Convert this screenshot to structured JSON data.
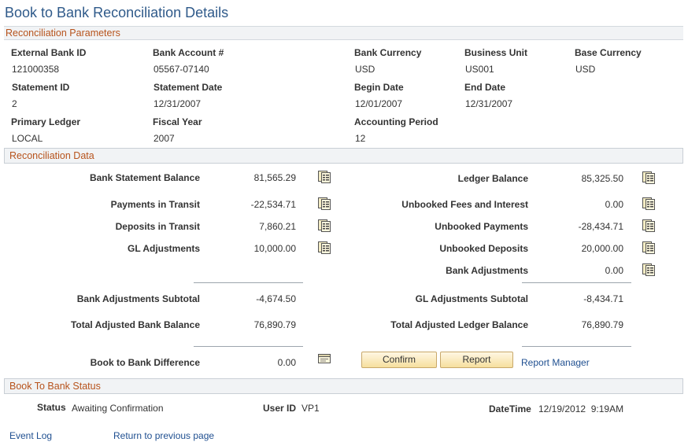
{
  "page": {
    "title": "Book to Bank Reconciliation Details"
  },
  "parameters": {
    "section_title": "Reconciliation Parameters",
    "external_bank_id": {
      "label": "External Bank ID",
      "value": "121000358"
    },
    "bank_account": {
      "label": "Bank Account #",
      "value": "05567-07140"
    },
    "bank_currency": {
      "label": "Bank Currency",
      "value": "USD"
    },
    "business_unit": {
      "label": "Business Unit",
      "value": "US001"
    },
    "base_currency": {
      "label": "Base Currency",
      "value": "USD"
    },
    "statement_id": {
      "label": "Statement ID",
      "value": "2"
    },
    "statement_date": {
      "label": "Statement Date",
      "value": "12/31/2007"
    },
    "begin_date": {
      "label": "Begin Date",
      "value": "12/01/2007"
    },
    "end_date": {
      "label": "End Date",
      "value": "12/31/2007"
    },
    "primary_ledger": {
      "label": "Primary Ledger",
      "value": "LOCAL"
    },
    "fiscal_year": {
      "label": "Fiscal Year",
      "value": "2007"
    },
    "accounting_period": {
      "label": "Accounting Period",
      "value": "12"
    }
  },
  "recon": {
    "section_title": "Reconciliation Data",
    "bank_statement_balance": {
      "label": "Bank Statement Balance",
      "value": "81,565.29"
    },
    "payments_in_transit": {
      "label": "Payments in Transit",
      "value": "-22,534.71"
    },
    "deposits_in_transit": {
      "label": "Deposits in Transit",
      "value": "7,860.21"
    },
    "gl_adjustments": {
      "label": "GL Adjustments",
      "value": "10,000.00"
    },
    "bank_adjustments_subtotal": {
      "label": "Bank Adjustments Subtotal",
      "value": "-4,674.50"
    },
    "total_adjusted_bank_balance": {
      "label": "Total Adjusted Bank Balance",
      "value": "76,890.79"
    },
    "book_to_bank_difference": {
      "label": "Book to Bank Difference",
      "value": "0.00"
    },
    "ledger_balance": {
      "label": "Ledger Balance",
      "value": "85,325.50"
    },
    "unbooked_fees": {
      "label": "Unbooked Fees and Interest",
      "value": "0.00"
    },
    "unbooked_payments": {
      "label": "Unbooked Payments",
      "value": "-28,434.71"
    },
    "unbooked_deposits": {
      "label": "Unbooked Deposits",
      "value": "20,000.00"
    },
    "bank_adjustments": {
      "label": "Bank Adjustments",
      "value": "0.00"
    },
    "gl_adjustments_subtotal": {
      "label": "GL Adjustments Subtotal",
      "value": "-8,434.71"
    },
    "total_adjusted_ledger_balance": {
      "label": "Total Adjusted Ledger Balance",
      "value": "76,890.79"
    },
    "confirm_label": "Confirm",
    "report_label": "Report",
    "report_manager_label": "Report Manager"
  },
  "status": {
    "section_title": "Book To Bank Status",
    "status_label": "Status",
    "status_value": "Awaiting Confirmation",
    "user_label": "User ID",
    "user_value": "VP1",
    "datetime_label": "DateTime",
    "datetime_value": "12/19/2012  9:19AM"
  },
  "footer": {
    "event_log_label": "Event Log",
    "return_label": "Return to previous page"
  },
  "icons": {
    "detail": "detail-icon",
    "notepad": "notepad-icon"
  },
  "colors": {
    "title": "#2f5a8a",
    "section_text": "#b7531c",
    "link": "#1f4f90",
    "button": "#f6df9e"
  }
}
